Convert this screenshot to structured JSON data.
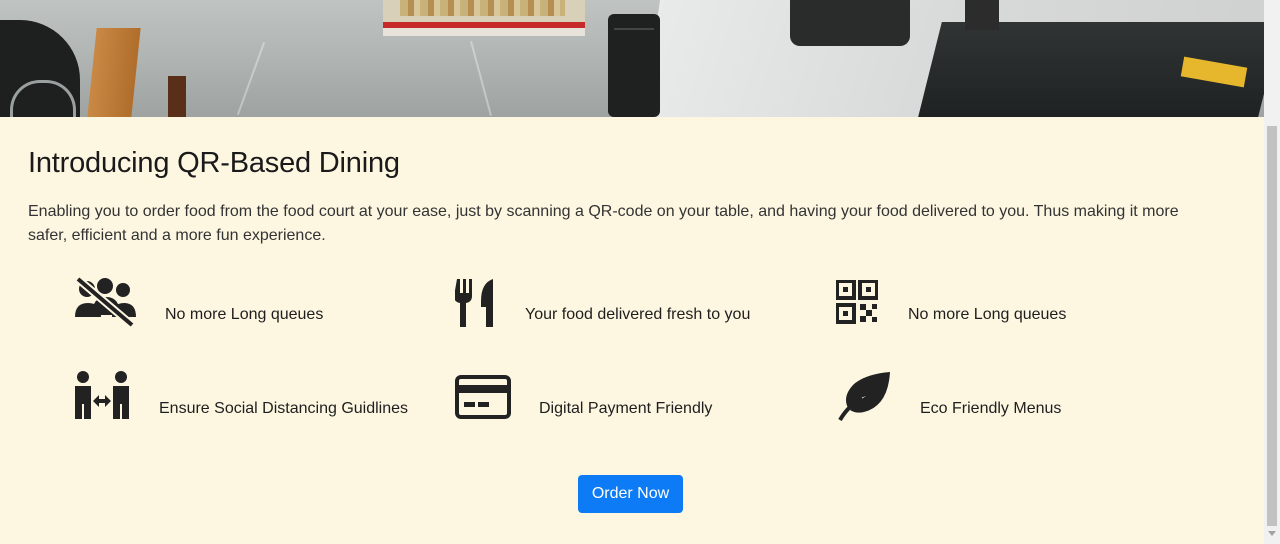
{
  "section": {
    "title": "Introducing QR-Based Dining",
    "description": "Enabling you to order food from the food court at your ease, just by scanning a QR-code on your table, and having your food delivered to you. Thus making it more safer, efficient and a more fun experience."
  },
  "features": [
    {
      "icon": "no-crowd-icon",
      "label": "No more Long queues"
    },
    {
      "icon": "utensils-icon",
      "label": "Your food delivered fresh to you"
    },
    {
      "icon": "qr-code-icon",
      "label": "No more Long queues"
    },
    {
      "icon": "social-distance-icon",
      "label": "Ensure Social Distancing Guidlines"
    },
    {
      "icon": "credit-card-icon",
      "label": "Digital Payment Friendly"
    },
    {
      "icon": "leaf-icon",
      "label": "Eco Friendly Menus"
    }
  ],
  "cta": {
    "label": "Order Now"
  },
  "colors": {
    "background": "#fdf7e2",
    "accent": "#0d7bf5",
    "icon": "#222222"
  }
}
